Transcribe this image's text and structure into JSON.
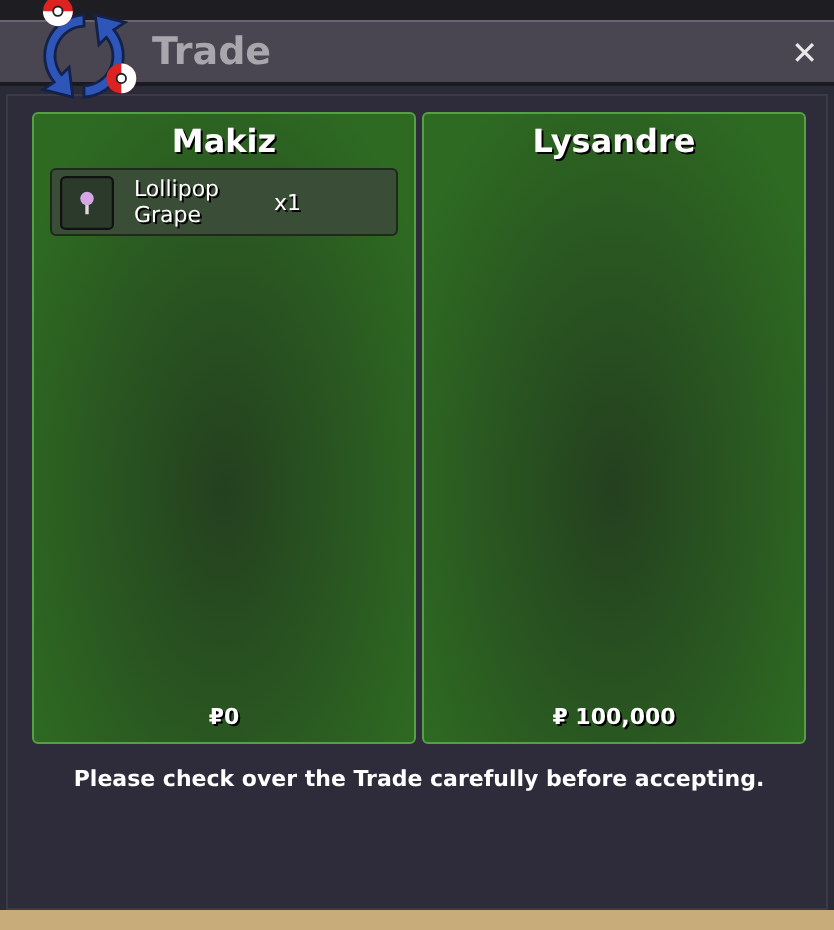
{
  "window": {
    "title": "Trade",
    "close": "✕"
  },
  "traders": [
    {
      "name": "Makiz",
      "items": [
        {
          "name": "Lollipop Grape",
          "quantity": "x1"
        }
      ],
      "money": "₽0"
    },
    {
      "name": "Lysandre",
      "money": "₽ 100,000"
    }
  ],
  "notice": "Please check over the Trade carefully before accepting."
}
